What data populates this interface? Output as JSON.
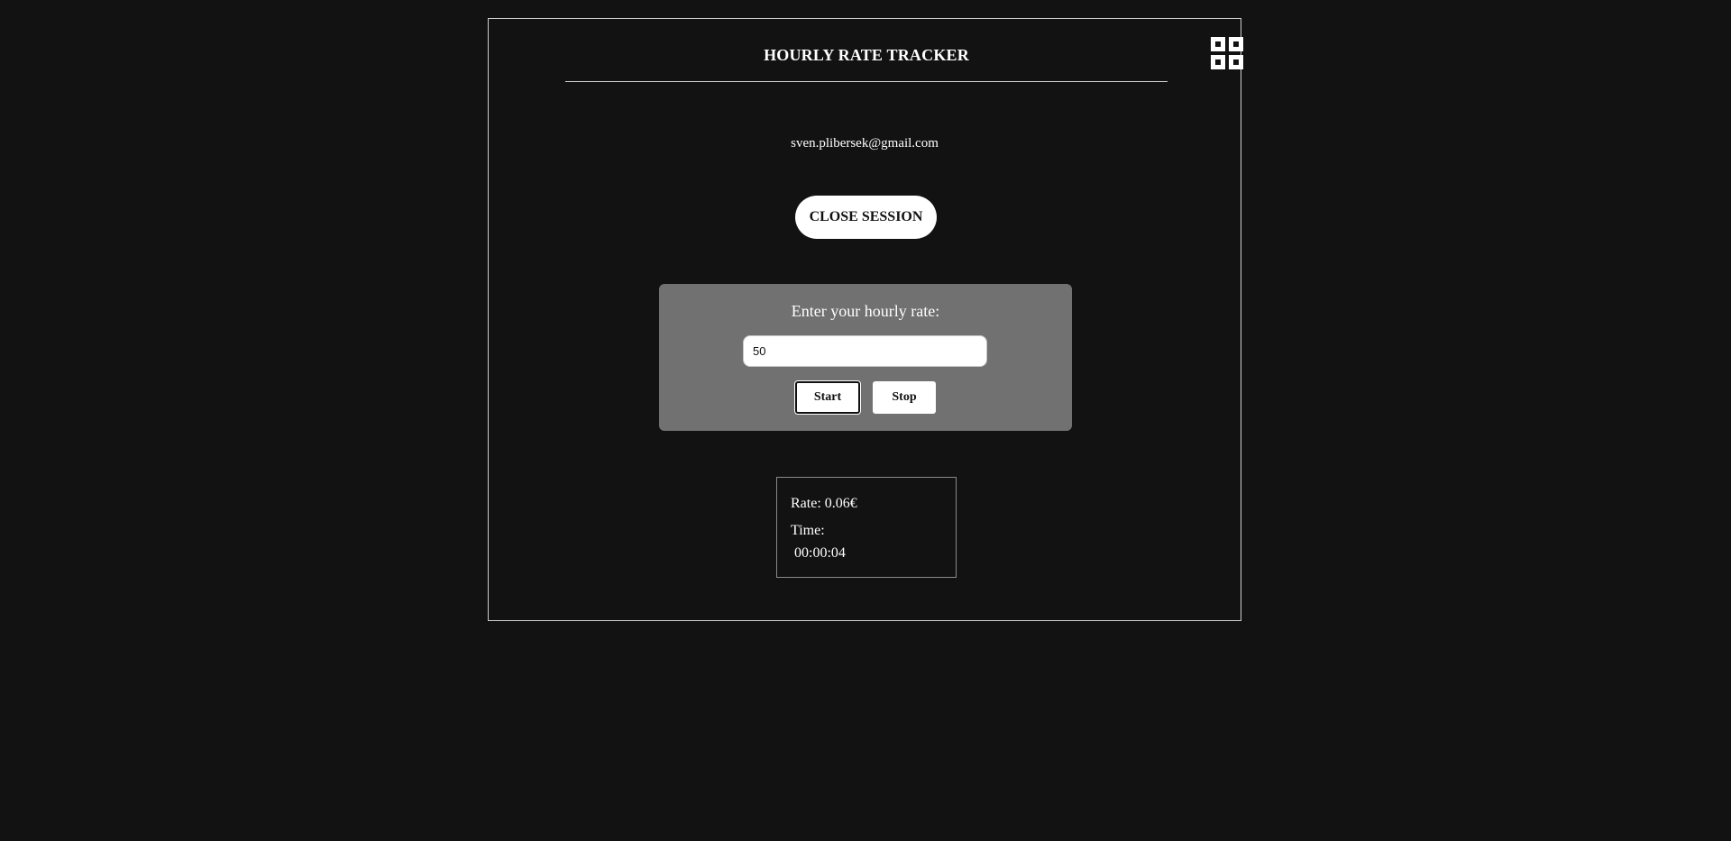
{
  "app": {
    "title": "HOURLY RATE TRACKER",
    "menu_icon": "grid-menu-icon"
  },
  "user": {
    "email": "sven.plibersek@gmail.com"
  },
  "session": {
    "close_label": "CLOSE SESSION"
  },
  "rate_form": {
    "label": "Enter your hourly rate:",
    "value": "50",
    "start_label": "Start",
    "stop_label": "Stop"
  },
  "stats": {
    "rate_text": "Rate: 0.06€",
    "time_label": "Time:",
    "time_value": " 00:00:04"
  },
  "colors": {
    "background": "#121212",
    "panel": "#717171",
    "button": "#ffffff",
    "text": "#ffffff"
  }
}
